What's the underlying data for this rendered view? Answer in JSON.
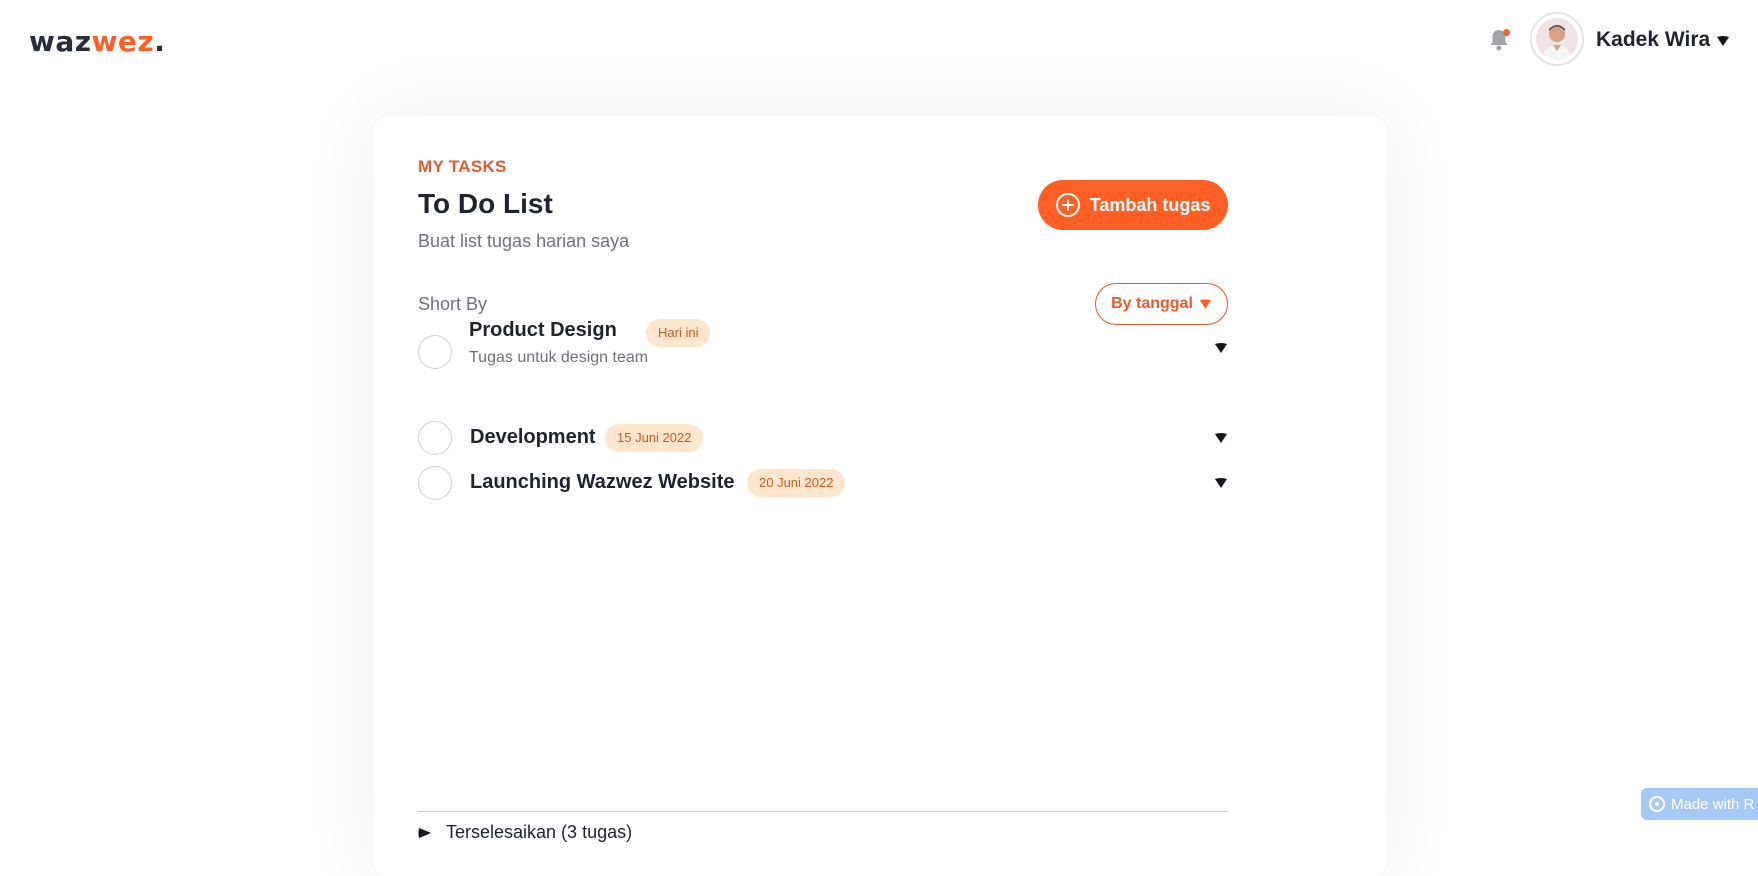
{
  "header": {
    "logo": {
      "part1": "waz",
      "part2": "wez",
      "part3": "."
    },
    "user": {
      "name": "Kadek Wira"
    }
  },
  "main": {
    "eyebrow": "MY TASKS",
    "title": "To Do List",
    "subtitle": "Buat list tugas harian saya",
    "add_button_label": "Tambah tugas",
    "sort_label": "Short By",
    "sort_button_label": "By tanggal",
    "tasks": [
      {
        "title": "Product Design",
        "badge": "Hari ini",
        "description": "Tugas untuk design team"
      },
      {
        "title": "Development",
        "badge": "15 Juni 2022"
      },
      {
        "title": "Launching Wazwez Website",
        "badge": "20 Juni 2022"
      }
    ],
    "completed_label": "Terselesaikan (3 tugas)"
  },
  "footer_badge": {
    "label": "Made with R"
  },
  "colors": {
    "accent": "#ff5e24",
    "accent_text": "#e8592b",
    "badge_bg": "#ffe6cc",
    "text_dark": "#1f2330",
    "text_muted": "#6f727a"
  }
}
